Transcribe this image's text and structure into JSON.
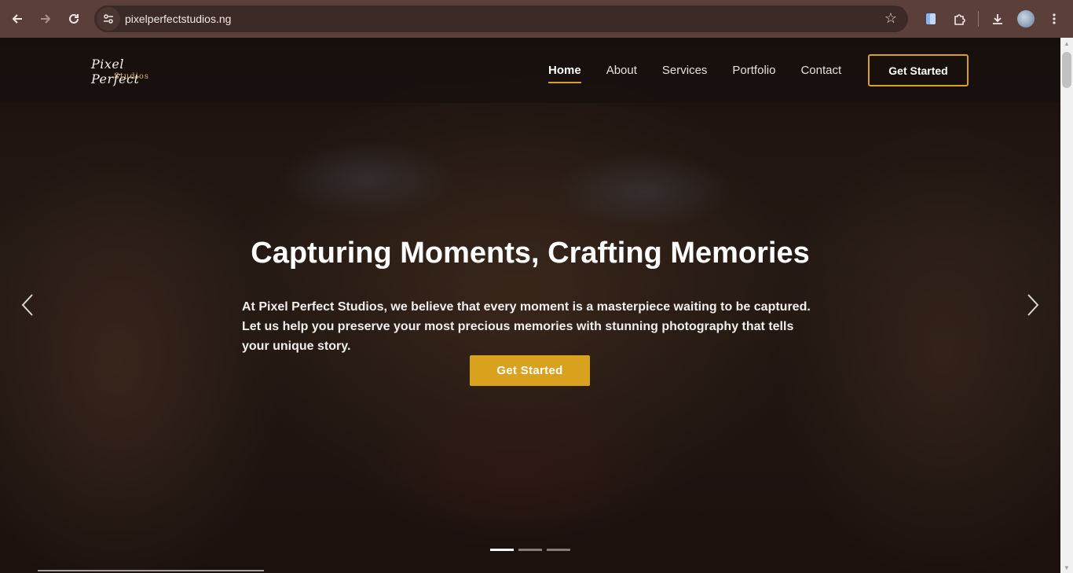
{
  "browser": {
    "url": "pixelperfectstudios.ng",
    "icons": {
      "back": "arrow-left-icon",
      "forward": "arrow-right-icon",
      "reload": "reload-icon",
      "site_info": "tune-icon",
      "bookmark": "star-icon",
      "extension_a": "reading-list-icon",
      "extension_b": "puzzle-icon",
      "downloads": "download-icon",
      "menu": "more-vert-icon"
    }
  },
  "header": {
    "logo_script": "Pixel Perfect",
    "logo_sub": "Studios",
    "nav": [
      "Home",
      "About",
      "Services",
      "Portfolio",
      "Contact"
    ],
    "active_nav": "Home",
    "cta": "Get Started"
  },
  "hero": {
    "title": "Capturing Moments, Crafting Memories",
    "body": "At Pixel Perfect Studios, we believe that every moment is a masterpiece waiting to be captured. Let us help you preserve your most precious memories with stunning photography that tells your unique story.",
    "cta": "Get Started",
    "slides_total": 3,
    "slide_active": 1
  },
  "colors": {
    "accent": "#d8a21f",
    "chrome": "#5a3f3b"
  }
}
